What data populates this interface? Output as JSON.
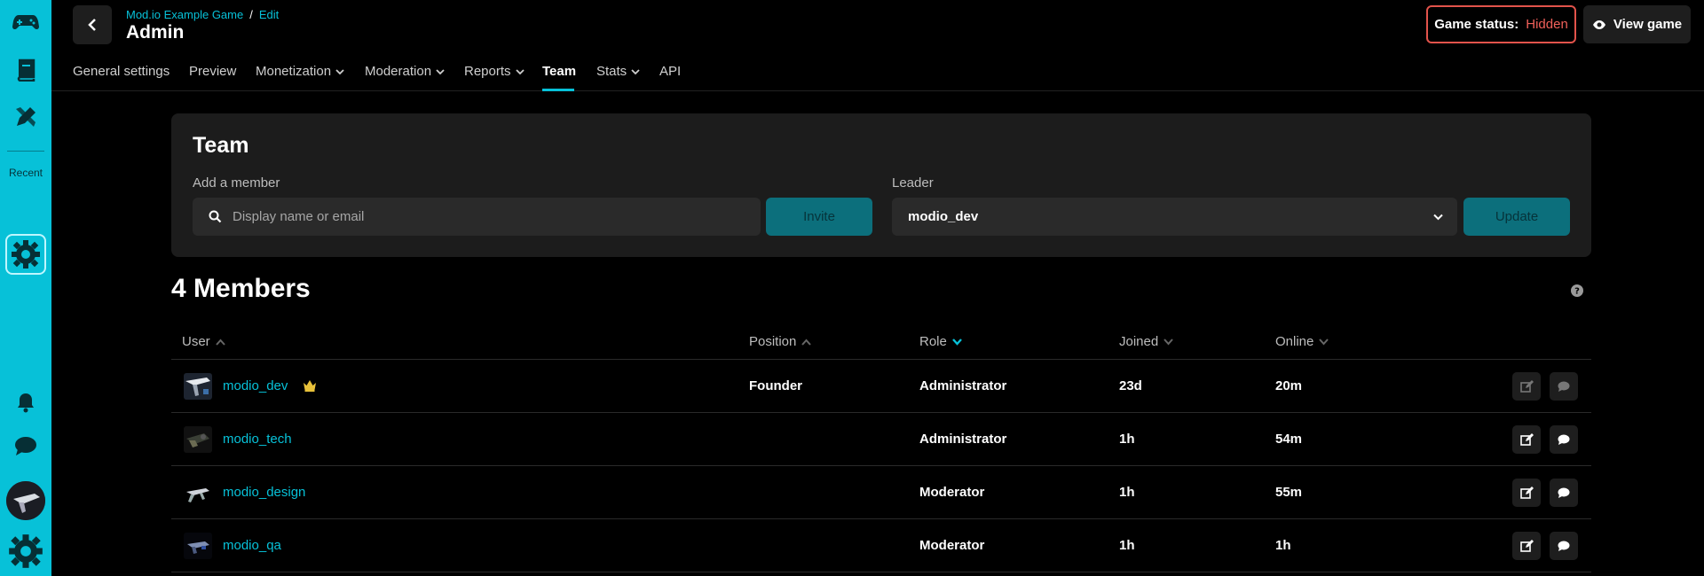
{
  "header": {
    "breadcrumb": {
      "parent": "Mod.io Example Game",
      "separator": "/",
      "current": "Edit"
    },
    "title": "Admin",
    "game_status_label": "Game status:",
    "game_status_value": "Hidden",
    "view_game_label": "View game"
  },
  "sidebar": {
    "recent_label": "Recent"
  },
  "tabs": [
    {
      "label": "General settings"
    },
    {
      "label": "Preview"
    },
    {
      "label": "Monetization"
    },
    {
      "label": "Moderation"
    },
    {
      "label": "Reports"
    },
    {
      "label": "Team"
    },
    {
      "label": "Stats"
    },
    {
      "label": "API"
    }
  ],
  "team": {
    "title": "Team",
    "add_member_label": "Add a member",
    "search_placeholder": "Display name or email",
    "invite_label": "Invite",
    "leader_label": "Leader",
    "leader_value": "modio_dev",
    "update_label": "Update"
  },
  "members": {
    "title": "4 Members",
    "columns": {
      "user": "User",
      "position": "Position",
      "role": "Role",
      "joined": "Joined",
      "online": "Online"
    },
    "rows": [
      {
        "user": "modio_dev",
        "position": "Founder",
        "role": "Administrator",
        "joined": "23d",
        "online": "20m"
      },
      {
        "user": "modio_tech",
        "position": "",
        "role": "Administrator",
        "joined": "1h",
        "online": "54m"
      },
      {
        "user": "modio_design",
        "position": "",
        "role": "Moderator",
        "joined": "1h",
        "online": "55m"
      },
      {
        "user": "modio_qa",
        "position": "",
        "role": "Moderator",
        "joined": "1h",
        "online": "1h"
      }
    ]
  },
  "colors": {
    "accent": "#07c1d8",
    "status_hidden": "#f0605a",
    "crown": "#e8c13a"
  }
}
